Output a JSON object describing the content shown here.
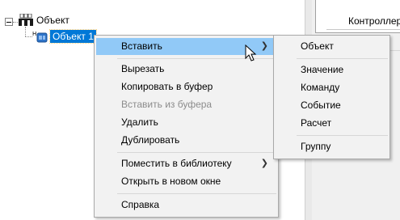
{
  "tree": {
    "root": {
      "label": "Объект",
      "icon": "object-group-icon"
    },
    "child": {
      "label": "Объект 1",
      "icon": "object-item-icon",
      "selected": true
    }
  },
  "right_panel": {
    "controller_label": "Контроллер :"
  },
  "context_menu": {
    "items": [
      {
        "label": "Вставить",
        "has_submenu": true,
        "state": "hover"
      },
      {
        "label": "Вырезать"
      },
      {
        "label": "Копировать в буфер"
      },
      {
        "label": "Вставить из буфера",
        "state": "disabled"
      },
      {
        "label": "Удалить"
      },
      {
        "label": "Дублировать"
      },
      {
        "label": "Поместить в библиотеку",
        "has_submenu": true
      },
      {
        "label": "Открыть в новом окне"
      },
      {
        "label": "Справка"
      }
    ]
  },
  "submenu": {
    "items": [
      {
        "label": "Объект"
      },
      {
        "label": "Значение"
      },
      {
        "label": "Команду"
      },
      {
        "label": "Событие"
      },
      {
        "label": "Расчет"
      },
      {
        "label": "Группу"
      }
    ]
  },
  "colors": {
    "selection": "#0078d7",
    "menu_hover": "#91c9f7",
    "menu_bg": "#f2f2f2"
  }
}
